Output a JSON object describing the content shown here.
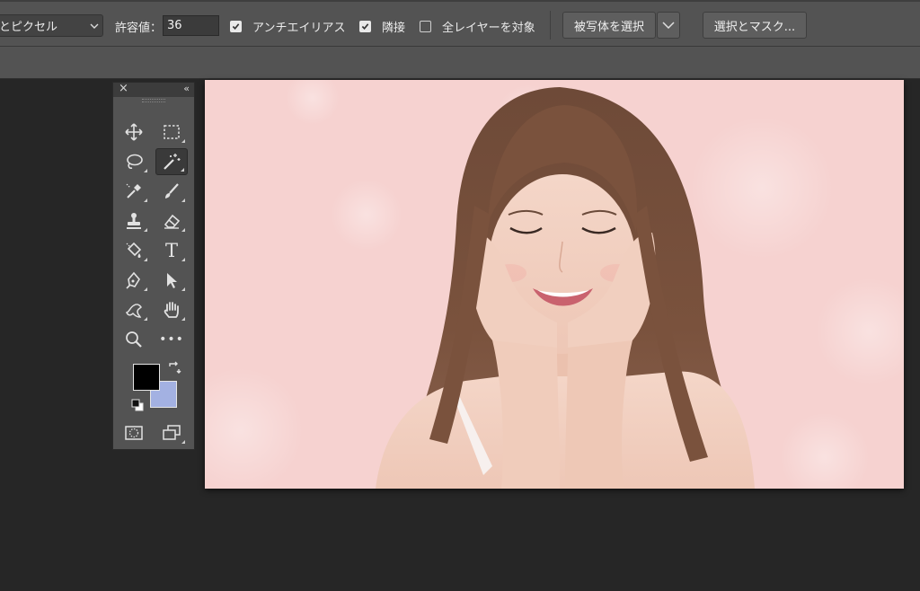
{
  "options_bar": {
    "sample_size": "とピクセル",
    "tolerance_label": "許容値：",
    "tolerance_value": "36",
    "antialias": {
      "label": "アンチエイリアス",
      "checked": true
    },
    "contiguous": {
      "label": "隣接",
      "checked": true
    },
    "all_layers": {
      "label": "全レイヤーを対象",
      "checked": false
    },
    "select_subject_label": "被写体を選択",
    "select_and_mask_label": "選択とマスク..."
  },
  "tools_panel": {
    "close_glyph": "×",
    "collapse_glyph": "‹‹",
    "tools": [
      {
        "icon": "move-icon",
        "active": false
      },
      {
        "icon": "rectangular-marquee-icon",
        "active": false
      },
      {
        "icon": "lasso-icon",
        "active": false
      },
      {
        "icon": "magic-wand-icon",
        "active": true
      },
      {
        "icon": "eyedropper-icon",
        "active": false
      },
      {
        "icon": "brush-icon",
        "active": false
      },
      {
        "icon": "clone-stamp-icon",
        "active": false
      },
      {
        "icon": "eraser-icon",
        "active": false
      },
      {
        "icon": "paint-bucket-icon",
        "active": false
      },
      {
        "icon": "type-icon",
        "active": false
      },
      {
        "icon": "pen-icon",
        "active": false
      },
      {
        "icon": "path-selection-icon",
        "active": false
      },
      {
        "icon": "puppet-warp-icon",
        "active": false
      },
      {
        "icon": "hand-icon",
        "active": false
      },
      {
        "icon": "zoom-icon",
        "active": false
      },
      {
        "icon": "more-tools-icon",
        "active": false
      },
      {
        "icon": "quick-mask-icon",
        "active": false
      },
      {
        "icon": "screen-mode-icon",
        "active": false
      }
    ],
    "type_tool_glyph": "T",
    "more_glyph": "•••",
    "foreground_color": "#000000",
    "background_color": "#a3b1e2"
  },
  "colors": {
    "ui_panel": "#535353",
    "ui_background": "#262626",
    "canvas_pink": "#f6d2d0"
  }
}
